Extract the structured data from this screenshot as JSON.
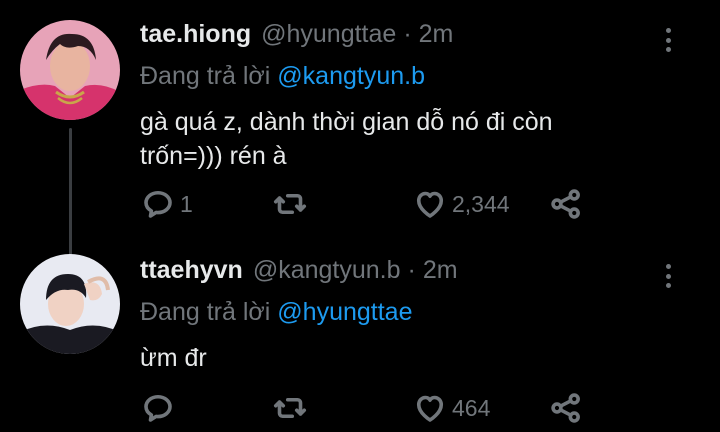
{
  "tweets": [
    {
      "display_name": "tae.hiong",
      "handle": "@hyungttae",
      "separator": "·",
      "time": "2m",
      "reply_prefix": "Đang trả lời",
      "reply_mention": "@kangtyun.b",
      "text": "gà quá z, dành thời gian dỗ nó đi còn trốn=))) rén à",
      "reply_count": "1",
      "retweet_count": "",
      "like_count": "2,344",
      "avatar_colors": [
        "#d6336c",
        "#2b1a1f",
        "#e8b4a0"
      ]
    },
    {
      "display_name": "ttaehyvn",
      "handle": "@kangtyun.b",
      "separator": "·",
      "time": "2m",
      "reply_prefix": "Đang trả lời",
      "reply_mention": "@hyungttae",
      "text": "ừm đr",
      "reply_count": "",
      "retweet_count": "",
      "like_count": "464",
      "avatar_colors": [
        "#e8eaf2",
        "#1a1a22",
        "#f0d2c4"
      ]
    }
  ],
  "icons": {
    "reply": "speech-bubble",
    "retweet": "arrows-loop",
    "like": "heart",
    "share": "share-nodes",
    "more": "vertical-ellipsis"
  },
  "theme": {
    "background": "#000000",
    "text": "#e7e9ea",
    "muted": "#71767b",
    "link": "#1d9bf0",
    "thread_line": "#3a3d41"
  }
}
